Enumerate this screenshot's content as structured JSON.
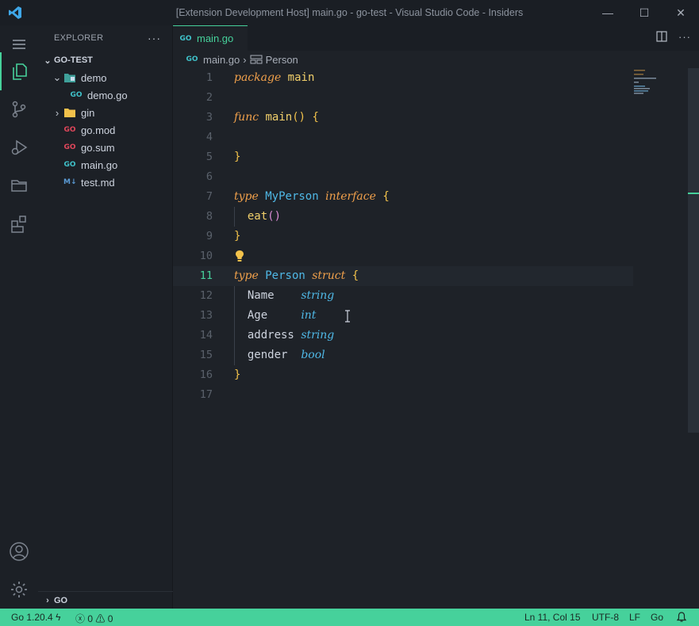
{
  "window": {
    "title": "[Extension Development Host] main.go - go-test - Visual Studio Code - Insiders",
    "min": "—",
    "max": "☐",
    "close": "✕"
  },
  "sidebar": {
    "header": "EXPLORER",
    "more": "···",
    "project": "GO-TEST",
    "items": [
      {
        "label": "demo",
        "icon": "folder-icon"
      },
      {
        "label": "demo.go",
        "icon": "go-file-icon"
      },
      {
        "label": "gin",
        "icon": "folder-icon"
      },
      {
        "label": "go.mod",
        "icon": "go-mod-icon"
      },
      {
        "label": "go.sum",
        "icon": "go-sum-icon"
      },
      {
        "label": "main.go",
        "icon": "go-file-icon"
      },
      {
        "label": "test.md",
        "icon": "markdown-icon"
      }
    ],
    "outline_section": "GO"
  },
  "editor": {
    "tab": "main.go",
    "breadcrumb": {
      "file": "main.go",
      "symbol": "Person"
    },
    "lines": [
      "1",
      "2",
      "3",
      "4",
      "5",
      "6",
      "7",
      "8",
      "9",
      "10",
      "11",
      "12",
      "13",
      "14",
      "15",
      "16",
      "17"
    ],
    "code": {
      "l1_kw": "package",
      "l1_name": "main",
      "l3_kw": "func",
      "l3_name": "main",
      "l3_parens": "()",
      "l3_brace": "{",
      "l5_brace": "}",
      "l7_kw": "type",
      "l7_name": "MyPerson",
      "l7_kw2": "interface",
      "l7_brace": "{",
      "l8_name": "eat",
      "l8_parens": "()",
      "l9_brace": "}",
      "l11_kw": "type",
      "l11_name": "Person",
      "l11_kw2": "struct",
      "l11_brace": "{",
      "l12_field": "Name   ",
      "l12_type": "string",
      "l13_field": "Age    ",
      "l13_type": "int",
      "l14_field": "address",
      "l14_type": "string",
      "l15_field": "gender ",
      "l15_type": "bool",
      "l16_brace": "}"
    },
    "current_line": "11"
  },
  "statusbar": {
    "go_version": "Go 1.20.4",
    "errors": "0",
    "warnings": "0",
    "cursor": "Ln 11, Col 15",
    "encoding": "UTF-8",
    "eol": "LF",
    "language": "Go"
  },
  "colors": {
    "accent": "#46d19b",
    "keyword": "#f0a04b",
    "type": "#4fb8e6",
    "function": "#f2d06b"
  }
}
